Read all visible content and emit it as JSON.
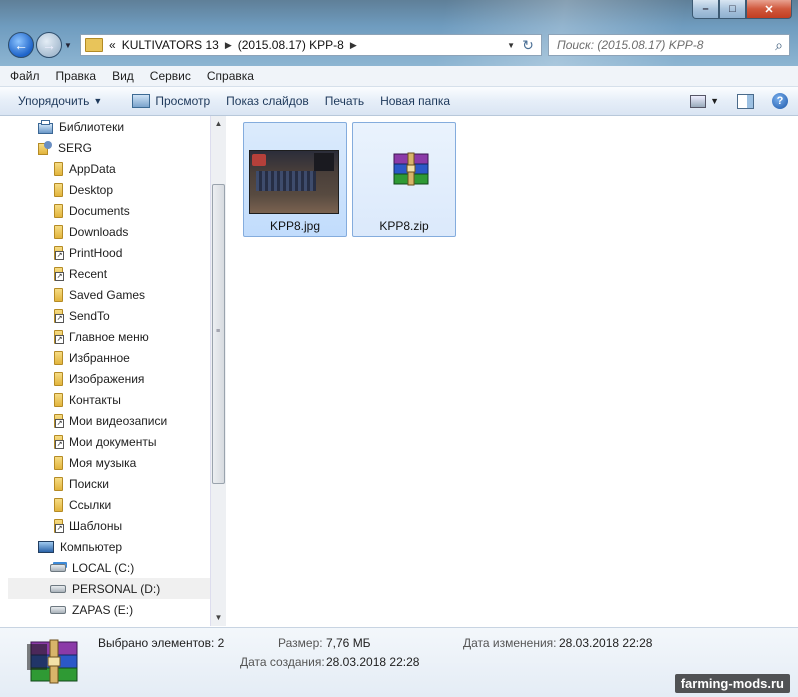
{
  "window": {
    "minimize": "–",
    "maximize": "□",
    "close": "✕"
  },
  "address": {
    "prefix": "«",
    "parts": [
      "KULTIVATORS 13",
      "(2015.08.17) KPP-8"
    ]
  },
  "search": {
    "placeholder": "Поиск: (2015.08.17) KPP-8"
  },
  "menu": [
    "Файл",
    "Правка",
    "Вид",
    "Сервис",
    "Справка"
  ],
  "toolbar": {
    "organize": "Упорядочить",
    "preview": "Просмотр",
    "slideshow": "Показ слайдов",
    "print": "Печать",
    "new_folder": "Новая папка"
  },
  "tree": [
    {
      "label": "Библиотеки",
      "icon": "library-icon",
      "indent": 0
    },
    {
      "label": "SERG",
      "icon": "user-folder-icon",
      "indent": 0
    },
    {
      "label": "AppData",
      "icon": "folder-icon",
      "indent": 1
    },
    {
      "label": "Desktop",
      "icon": "desktop-folder-icon",
      "indent": 1
    },
    {
      "label": "Documents",
      "icon": "folder-icon",
      "indent": 1
    },
    {
      "label": "Downloads",
      "icon": "downloads-folder-icon",
      "indent": 1
    },
    {
      "label": "PrintHood",
      "icon": "shortcut-folder-icon",
      "indent": 1
    },
    {
      "label": "Recent",
      "icon": "shortcut-folder-icon",
      "indent": 1
    },
    {
      "label": "Saved Games",
      "icon": "saved-games-folder-icon",
      "indent": 1
    },
    {
      "label": "SendTo",
      "icon": "shortcut-folder-icon",
      "indent": 1
    },
    {
      "label": "Главное меню",
      "icon": "shortcut-folder-icon",
      "indent": 1
    },
    {
      "label": "Избранное",
      "icon": "favorites-folder-icon",
      "indent": 1
    },
    {
      "label": "Изображения",
      "icon": "pictures-folder-icon",
      "indent": 1
    },
    {
      "label": "Контакты",
      "icon": "contacts-folder-icon",
      "indent": 1
    },
    {
      "label": "Мои видеозаписи",
      "icon": "shortcut-folder-icon",
      "indent": 1
    },
    {
      "label": "Мои документы",
      "icon": "shortcut-folder-icon",
      "indent": 1
    },
    {
      "label": "Моя музыка",
      "icon": "music-folder-icon",
      "indent": 1
    },
    {
      "label": "Поиски",
      "icon": "searches-folder-icon",
      "indent": 1
    },
    {
      "label": "Ссылки",
      "icon": "links-folder-icon",
      "indent": 1
    },
    {
      "label": "Шаблоны",
      "icon": "shortcut-folder-icon",
      "indent": 1
    },
    {
      "label": "Компьютер",
      "icon": "computer-icon",
      "indent": 0
    },
    {
      "label": "LOCAL (C:)",
      "icon": "system-drive-icon",
      "indent": 1
    },
    {
      "label": "PERSONAL (D:)",
      "icon": "drive-icon",
      "indent": 1,
      "selected": true
    },
    {
      "label": "ZAPAS (E:)",
      "icon": "drive-icon",
      "indent": 1
    }
  ],
  "files": [
    {
      "name": "KPP8.jpg",
      "type": "image"
    },
    {
      "name": "KPP8.zip",
      "type": "winrar-archive"
    }
  ],
  "status": {
    "selected_label": "Выбрано элементов: 2",
    "size_label": "Размер:",
    "size_value": "7,76 МБ",
    "modified_label": "Дата изменения:",
    "modified_value": "28.03.2018 22:28",
    "created_label": "Дата создания:",
    "created_value": "28.03.2018 22:28"
  },
  "watermark": "farming-mods.ru",
  "colors": {
    "titlebar": "#6f9cbf",
    "selection": "#c1dcfc",
    "selection_border": "#84acdd"
  }
}
